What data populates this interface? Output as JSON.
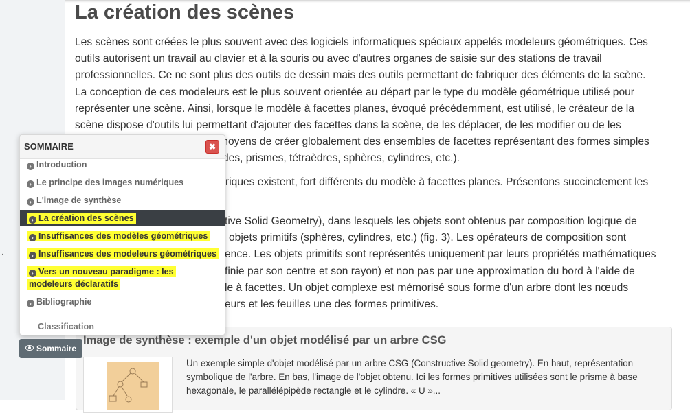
{
  "page": {
    "title": "La création des scènes",
    "paragraphs": [
      [
        "Les scènes sont créées le plus souvent avec des logiciels informatiques spéciaux appelés modeleurs géométriques. Ces",
        "outils autorisent un travail au clavier et à la souris ou avec d'autres organes de saisie sur des stations de travail",
        "professionnelles. Ce ne sont plus des outils de dessin mais des outils permettant de fabriquer des éléments de la scène.",
        "La conception de ces modeleurs est le plus souvent orientée au départ par le type du modèle géométrique utilisé pour",
        "représenter une scène. Ainsi, lorsque le modèle à facettes planes, évoqué précédemment, est utilisé, le créateur de la",
        "scène dispose d'outils lui permettant d'ajouter des facettes dans la scène, de les déplacer, de les modifier ou de les",
        "moyens de créer globalement des ensembles de facettes représentant des formes simples",
        "des, prismes, tétraèdres, sphères, cylindres, etc.)."
      ],
      [
        "riques existent, fort différents du modèle à facettes planes. Présentons succinctement les"
      ],
      [
        "tive Solid Geometry), dans lesquels les objets sont obtenus par composition logique de",
        "objets primitifs (sphères, cylindres, etc.) (fig. 3). Les opérateurs de composition sont",
        "ence. Les objets primitifs sont représentés uniquement par leurs propriétés mathématiques",
        "finie par son centre et son rayon) et non pas par une approximation du bord à l'aide de",
        "le à facettes. Un objet complexe est mémorisé sous forme d'un arbre dont les nœuds",
        "eurs et les feuilles une des formes primitives."
      ]
    ]
  },
  "figure": {
    "title": "Image de synthèse : exemple d'un objet modélisé par un arbre CSG",
    "caption": [
      "Un exemple simple d'objet modélisé par un arbre CSG (Constructive Solid geometry). En haut, représentation",
      "symbolique de l'arbre. En bas, l'image de l'objet obtenu. Ici les formes primitives utilisées sont le prisme à base",
      "hexagonale, le parallélépipède rectangle et le cylindre. « U »..."
    ]
  },
  "toc": {
    "title": "SOMMAIRE",
    "close_icon": "close-icon",
    "items": [
      {
        "label": "Introduction",
        "highlighted": false,
        "active": false
      },
      {
        "label": "Le principe des images numériques",
        "highlighted": false,
        "active": false
      },
      {
        "label": "L'image de synthèse",
        "highlighted": false,
        "active": false
      },
      {
        "label": "La création des scènes",
        "highlighted": true,
        "active": true
      },
      {
        "label": "Insuffisances des modèles géométriques",
        "highlighted": true,
        "active": false
      },
      {
        "label": "Insuffisances des modeleurs géométriques",
        "highlighted": true,
        "active": false
      },
      {
        "label": "Vers un nouveau paradigme : les",
        "label_line2": "modeleurs déclaratifs",
        "highlighted": true,
        "active": false
      },
      {
        "label": "Bibliographie",
        "highlighted": false,
        "active": false
      }
    ],
    "classification": "Classification"
  },
  "sommaire_button": {
    "label": "Sommaire",
    "icon": "eye-icon"
  },
  "colors": {
    "highlight": "#ffff33",
    "active_bg": "#3a3f44",
    "close_bg": "#d9534f",
    "button_bg": "#5f6b73"
  }
}
